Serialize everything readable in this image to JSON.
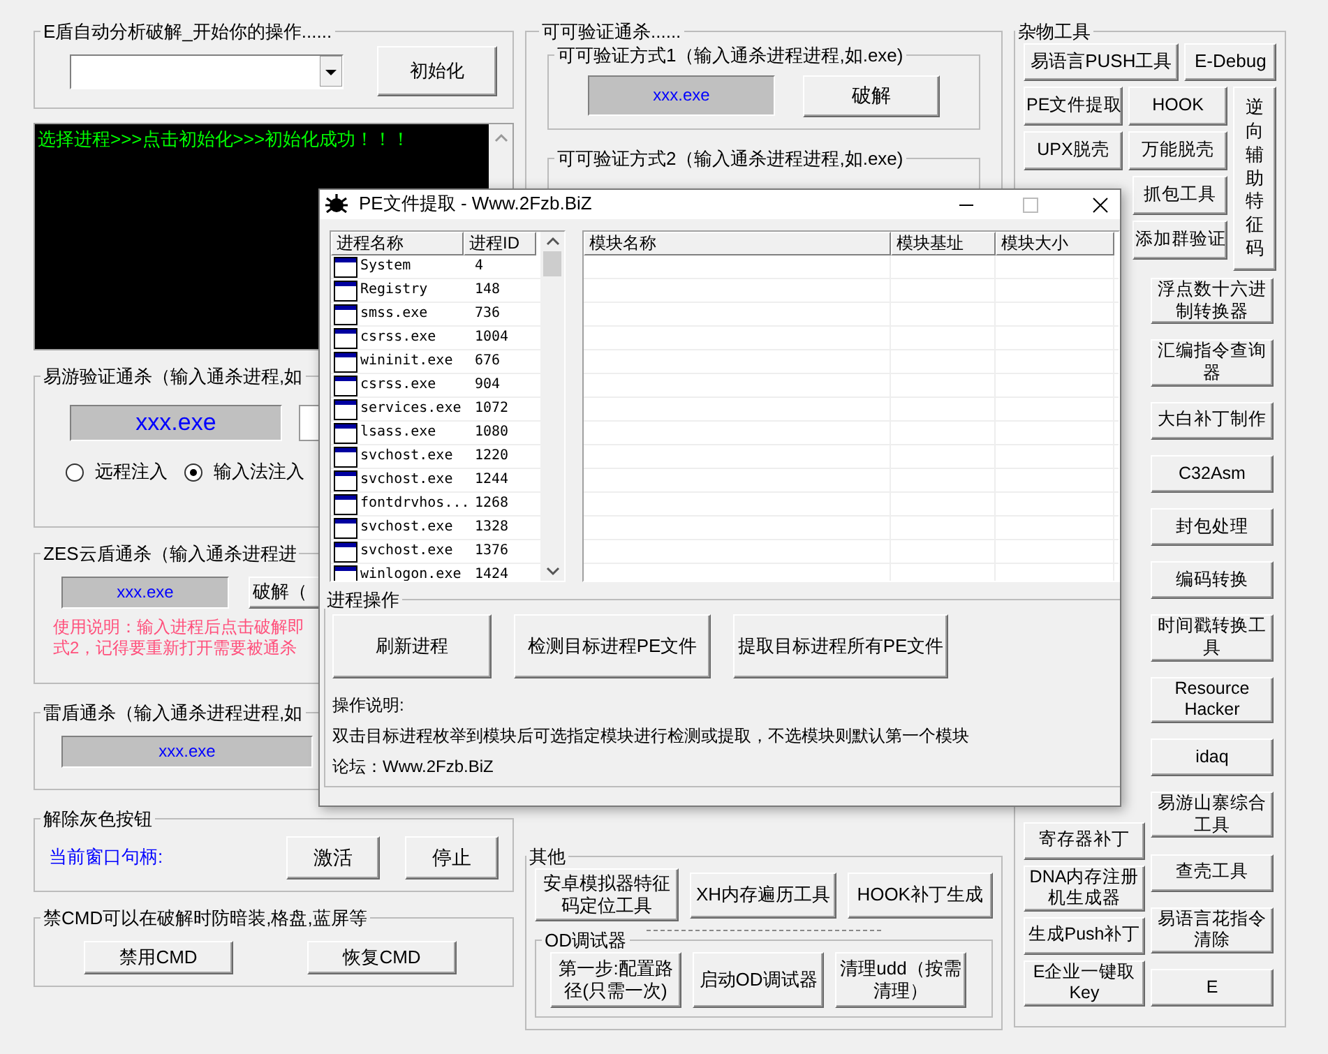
{
  "main": {
    "init_group": {
      "title": "E盾自动分析破解_开始你的操作......",
      "init_button": "初始化"
    },
    "console": {
      "text": "选择进程>>>点击初始化>>>初始化成功！！！"
    },
    "yiyou_group": {
      "title": "易游验证通杀（输入通杀进程,如",
      "process_field": {
        "value": "xxx.exe"
      },
      "radios": [
        {
          "label": "远程注入",
          "selected": false
        },
        {
          "label": "输入法注入",
          "selected": true
        }
      ]
    },
    "zes_group": {
      "title": "ZES云盾通杀（输入通杀进程进",
      "process_field": {
        "value": "xxx.exe"
      },
      "crack_button": "破解（",
      "notes": [
        "使用说明：输入进程后点击破解即",
        "式2，记得要重新打开需要被通杀"
      ]
    },
    "leidun_group": {
      "title": "雷盾通杀（输入通杀进程进程,如",
      "process_field": {
        "value": "xxx.exe"
      }
    },
    "ungray_group": {
      "title": "解除灰色按钮",
      "handle_label": "当前窗口句柄:",
      "buttons": [
        "激活",
        "停止"
      ]
    },
    "cmd_group": {
      "title": "禁CMD可以在破解时防暗装,格盘,蓝屏等",
      "buttons": [
        "禁用CMD",
        "恢复CMD"
      ]
    },
    "keke_group": {
      "title": "可可验证通杀......",
      "method1": {
        "title": "可可验证方式1（输入通杀进程进程,如.exe)",
        "process_field": {
          "value": "xxx.exe"
        },
        "crack_button": "破解"
      },
      "method2": {
        "title": "可可验证方式2（输入通杀进程进程,如.exe)"
      }
    },
    "other_group": {
      "title": "其他",
      "buttons": [
        "安卓模拟器特征码定位工具",
        "XH内存遍历工具",
        "HOOK补丁生成"
      ],
      "od_group": {
        "title": "OD调试器",
        "buttons": [
          "第一步:配置路径(只需一次)",
          "启动OD调试器",
          "清理udd（按需清理）"
        ]
      }
    },
    "tools_group": {
      "title": "杂物工具",
      "top_rows": [
        [
          "易语言PUSH工具",
          "E-Debug"
        ]
      ],
      "side_rows": [
        [
          "PE文件提取",
          "HOOK"
        ],
        [
          "UPX脱壳",
          "万能脱壳"
        ],
        [
          "抓包工具"
        ],
        [
          "添加群验证"
        ]
      ],
      "tall_button": "逆向辅助特征码",
      "right_column": [
        "浮点数十六进制转换器",
        "汇编指令查询器",
        "大白补丁制作",
        "C32Asm",
        "封包处理",
        "编码转换",
        "时间戳转换工具",
        "Resource Hacker",
        "idaq",
        "易游山寨综合工具",
        "查壳工具",
        "易语言花指令清除",
        "E"
      ],
      "left_column": [
        "寄存器补丁",
        "DNA内存注册机生成器",
        "生成Push补丁",
        "E企业一键取Key"
      ]
    }
  },
  "dialog": {
    "title": "PE文件提取 - Www.2Fzb.BiZ",
    "process_list": {
      "columns": [
        "进程名称",
        "进程ID"
      ],
      "rows": [
        {
          "name": "System",
          "pid": "4"
        },
        {
          "name": "Registry",
          "pid": "148"
        },
        {
          "name": "smss.exe",
          "pid": "736"
        },
        {
          "name": "csrss.exe",
          "pid": "1004"
        },
        {
          "name": "wininit.exe",
          "pid": "676"
        },
        {
          "name": "csrss.exe",
          "pid": "904"
        },
        {
          "name": "services.exe",
          "pid": "1072"
        },
        {
          "name": "lsass.exe",
          "pid": "1080"
        },
        {
          "name": "svchost.exe",
          "pid": "1220"
        },
        {
          "name": "svchost.exe",
          "pid": "1244"
        },
        {
          "name": "fontdrvhos...",
          "pid": "1268"
        },
        {
          "name": "svchost.exe",
          "pid": "1328"
        },
        {
          "name": "svchost.exe",
          "pid": "1376"
        },
        {
          "name": "winlogon.exe",
          "pid": "1424"
        }
      ]
    },
    "module_list": {
      "columns": [
        "模块名称",
        "模块基址",
        "模块大小"
      ]
    },
    "ops_group": {
      "title": "进程操作",
      "buttons": [
        "刷新进程",
        "检测目标进程PE文件",
        "提取目标进程所有PE文件"
      ],
      "texts": [
        "操作说明:",
        "双击目标进程枚举到模块后可选指定模块进行检测或提取，不选模块则默认第一个模块",
        "论坛：Www.2Fzb.BiZ"
      ]
    }
  }
}
